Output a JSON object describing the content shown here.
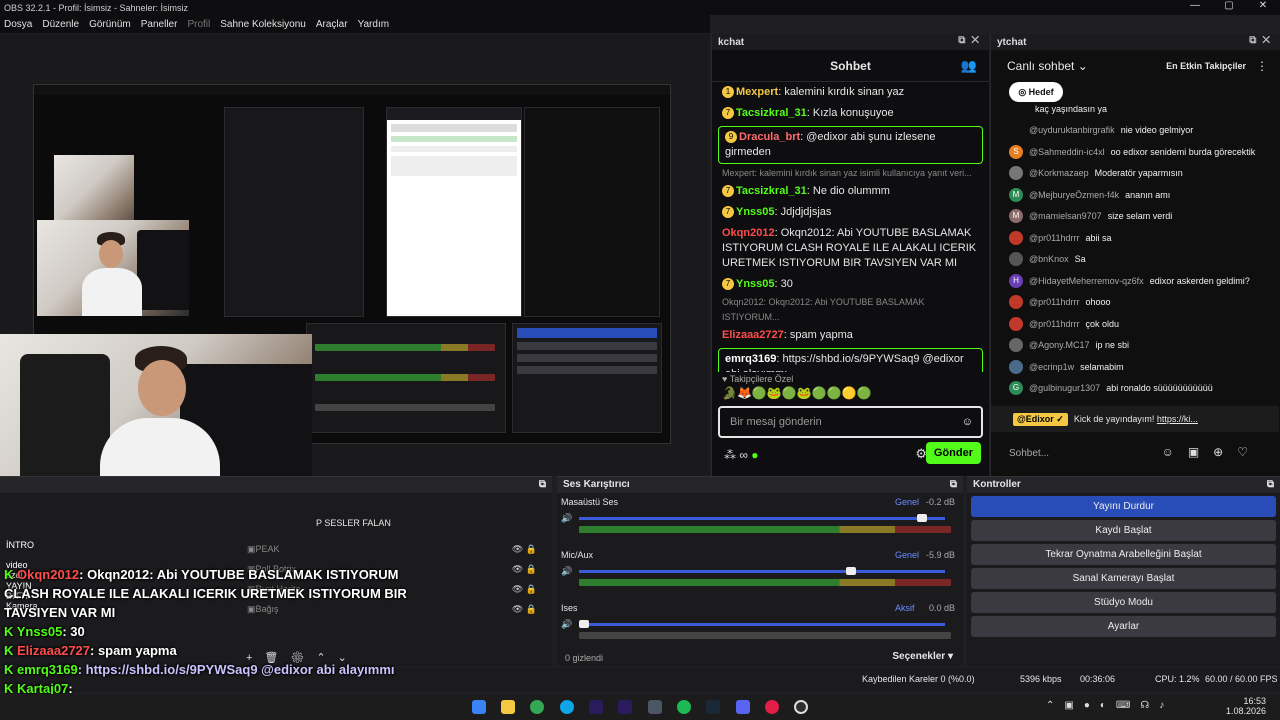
{
  "window": {
    "title": "OBS 32.2.1 - Profil: İsimsiz - Sahneler: İsimsiz",
    "controls": [
      "—",
      "▢",
      "✕"
    ]
  },
  "menu": [
    "Dosya",
    "Düzenle",
    "Görünüm",
    "Paneller",
    "Profil",
    "Sahne Koleksiyonu",
    "Araçlar",
    "Yardım"
  ],
  "kchat": {
    "dock_title": "kchat",
    "header": "Sohbet",
    "messages": [
      {
        "badge": "1",
        "user": "Mexpert",
        "color": "#f5c842",
        "text": "kalemini kırdık sinan yaz"
      },
      {
        "badge": "7",
        "user": "Tacsizkral_31",
        "color": "#53fc18",
        "text": "Kızla konuşuyoe"
      },
      {
        "badge": "9",
        "user": "Dracula_brt",
        "color": "#ff6b6b",
        "text": "@edixor abi şunu izlesene girmeden",
        "boxed": true
      },
      {
        "reply": "Mexpert: kalemini kırdık sinan yaz isimli kullanıcıya yanıt veri..."
      },
      {
        "badge": "7",
        "user": "Tacsizkral_31",
        "color": "#53fc18",
        "text": "Ne dio olummm"
      },
      {
        "badge": "7",
        "user": "Ynss05",
        "color": "#53fc18",
        "text": "Jdjdjdjsjas"
      },
      {
        "user": "Okqn2012",
        "color": "#ff4d4d",
        "text": "Okqn2012: Abi YOUTUBE BASLAMAK ISTIYORUM CLASH ROYALE ILE ALAKALI ICERIK URETMEK ISTIYORUM BIR TAVSIYEN VAR MI"
      },
      {
        "badge": "7",
        "user": "Ynss05",
        "color": "#53fc18",
        "text": "30"
      },
      {
        "reply": "Okqn2012: Okqn2012: Abi YOUTUBE BASLAMAK ISTIYORUM..."
      },
      {
        "user": "Elizaaa2727",
        "color": "#ff4d4d",
        "text": "spam yapma"
      },
      {
        "user": "emrq3169",
        "color": "#ffffff",
        "text": "https://shbd.io/s/9PYWSaq9 @edixor abi alayımmı",
        "boxed": true
      },
      {
        "user": "Kartaj07",
        "color": "#53fc18",
        "text": "💀"
      }
    ],
    "followers_label": "Takipçilere Özel",
    "input_placeholder": "Bir mesaj gönderin",
    "send_label": "Gönder"
  },
  "ytchat": {
    "dock_title": "ytchat",
    "mode": "Canlı sohbet",
    "top_supporters": "En Etkin Takipçiler",
    "goal_label": "Hedef",
    "messages": [
      {
        "user": "",
        "text": "kaç yaşındasın ya",
        "av": "#0f0f0f",
        "letter": ""
      },
      {
        "user": "@uyduruktanbirgrafik",
        "text": "nie video gelmiyor",
        "av": "#0f0f0f",
        "letter": ""
      },
      {
        "user": "@Sahmeddin-ic4xl",
        "text": "oo edixor senidemi burda görecektik",
        "av": "#e67e22",
        "letter": "S"
      },
      {
        "user": "@Korkmazaep",
        "text": "Moderatör yaparmısın",
        "av": "#777",
        "letter": ""
      },
      {
        "user": "@MejburyeÖzmen-f4k",
        "text": "ananın amı",
        "av": "#2e8b57",
        "letter": "M"
      },
      {
        "user": "@mamielsan9707",
        "text": "size selam verdi",
        "av": "#8e6b6b",
        "letter": "M"
      },
      {
        "user": "@pr011hdrrr",
        "text": "abii sa",
        "av": "#c0392b",
        "letter": ""
      },
      {
        "user": "@bnKnox",
        "text": "Sa",
        "av": "#555",
        "letter": ""
      },
      {
        "user": "@HidayetMeherremov-qz6fx",
        "text": "edixor askerden geldimi?",
        "av": "#6a3fb5",
        "letter": "H"
      },
      {
        "user": "@pr011hdrrr",
        "text": "ohooo",
        "av": "#c0392b",
        "letter": ""
      },
      {
        "user": "@pr011hdrrr",
        "text": "çok oldu",
        "av": "#c0392b",
        "letter": ""
      },
      {
        "user": "@Agony.MC17",
        "text": "ip ne sbi",
        "av": "#666",
        "letter": ""
      },
      {
        "user": "@ecrinp1w",
        "text": "selamabim",
        "av": "#4a6a8a",
        "letter": ""
      },
      {
        "user": "@gulbinugur1307",
        "text": "abi ronaldo süüüüüüüüüüü",
        "av": "#2e8b57",
        "letter": "G"
      }
    ],
    "pinned_user": "@Edixor ✓",
    "pinned_text": "Kick de yayındayım!",
    "pinned_link": "https://ki...",
    "input_placeholder": "Sohbet..."
  },
  "sources": {
    "items": [
      "PEAK",
      "Poll Botrix",
      "Rust Harita",
      "Bağış"
    ],
    "partial_label": "P SESLER FALAN",
    "hidden_count": "0 gizlendi"
  },
  "mixer": {
    "title": "Ses Karıştırıcı",
    "channels": [
      {
        "name": "Masaüstü Ses",
        "tag": "Genel",
        "db": "-0.2 dB",
        "level": 0.95
      },
      {
        "name": "Mic/Aux",
        "tag": "Genel",
        "db": "-5.9 dB",
        "level": 0.75
      },
      {
        "name": "Ises",
        "tag": "Aksif",
        "db": "0.0 dB",
        "level": 0.0
      }
    ],
    "scale": [
      "-60",
      "-54",
      "-48",
      "-42",
      "-36",
      "-30",
      "-24",
      "-18",
      "-12",
      "-6",
      "0"
    ],
    "footer_label": "Seçenekler"
  },
  "controls": {
    "title": "Kontroller",
    "buttons": [
      "Yayını Durdur",
      "Kaydı Başlat",
      "Tekrar Oynatma Arabelleğini Başlat",
      "Sanal Kamerayı Başlat",
      "Stüdyo Modu",
      "Ayarlar"
    ]
  },
  "status": {
    "dropped": "Kaybedilen Kareler 0 (%0.0)",
    "bitrate": "5396 kbps",
    "time": "00:36:06",
    "cpu": "CPU: 1.2%",
    "fps": "60.00 / 60.00 FPS"
  },
  "overlay": {
    "intro": "İNTRO",
    "video_ozel": "video özel",
    "yayin_bitti": "YAYIN BİTTİ",
    "kamera": "Kamera",
    "lines": [
      {
        "user": "Okqn2012",
        "text": ": Okqn2012: Abi YOUTUBE BASLAMAK ISTIYORUM"
      },
      {
        "user": "",
        "text": "CLASH ROYALE ILE ALAKALI ICERIK URETMEK ISTIYORUM BIR"
      },
      {
        "user": "",
        "text": "TAVSIYEN VAR MI"
      },
      {
        "user": "Ynss05",
        "text": ": 30"
      },
      {
        "user": "Elizaaa2727",
        "text": ": spam yapma"
      },
      {
        "user": "emrq3169",
        "text": ": https://shbd.io/s/9PYWSaq9 @edixor abi alayımmı"
      },
      {
        "user": "Kartaj07",
        "text": ":"
      }
    ]
  },
  "clock": {
    "time": "16:53",
    "date": "1.08.2026"
  }
}
